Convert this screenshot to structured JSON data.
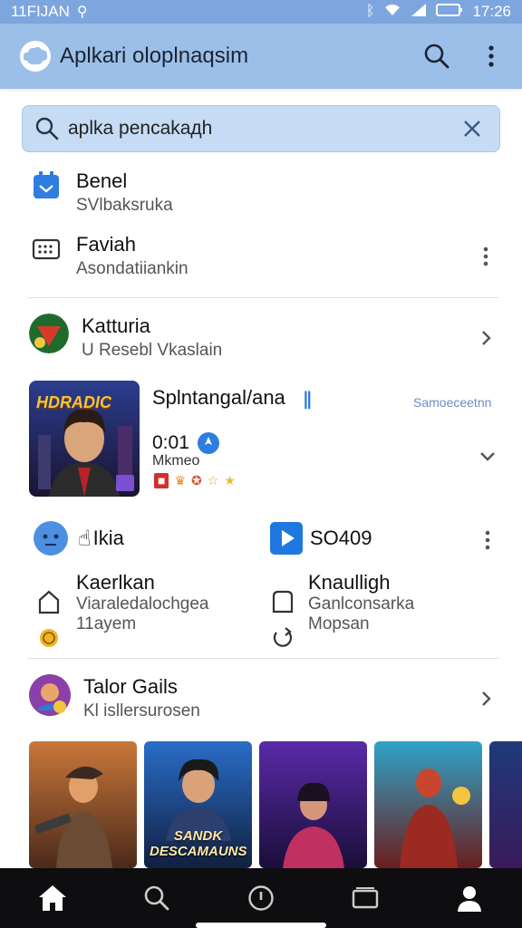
{
  "status_bar": {
    "left_text": "11FIJAN",
    "time": "17:26"
  },
  "app_bar": {
    "title": "Aplkari oloplnaqsim"
  },
  "search": {
    "value": "aplka pencakaдh"
  },
  "list": [
    {
      "title": "Benel",
      "subtitle": "SVlbaksruka"
    },
    {
      "title": "Faviah",
      "subtitle": "Asondatiiankin"
    },
    {
      "title": "Katturia",
      "subtitle": "U Resebl Vkaslain"
    }
  ],
  "featured_game": {
    "name": "Splntangal/ana",
    "tag": "Samoeceetnn",
    "rating": "0:01",
    "subtitle": "Mkmeo",
    "thumb_text": "HDRADIC"
  },
  "grid": [
    {
      "title": "Ikia"
    },
    {
      "title": "SO409"
    },
    {
      "title": "Kaerlkan",
      "subtitle": "Viaraledalochgea",
      "meta": "11ayem"
    },
    {
      "title": "Knaulligh",
      "subtitle": "Ganlconsarka",
      "meta": "Mopsan"
    }
  ],
  "section": {
    "title": "Talor Gails",
    "subtitle": "Kl isllersurosen"
  },
  "thumbnails": [
    {
      "label": ""
    },
    {
      "label": "SANDK DESCAMAUNS"
    },
    {
      "label": ""
    },
    {
      "label": ""
    },
    {
      "label": ""
    }
  ],
  "colors": {
    "app_bar": "#9cbfe9",
    "status_bar": "#7ea6de",
    "search_bg": "#c6dbf4",
    "accent": "#2e7de0",
    "bottom_nav": "#0e0e10"
  }
}
